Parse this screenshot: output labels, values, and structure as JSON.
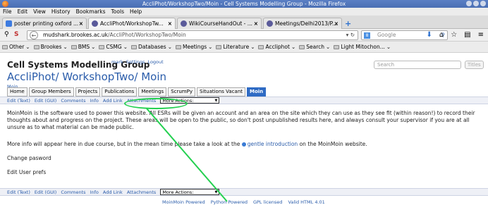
{
  "window": {
    "title": "AccliPhot/WorkshopTwo/Moin - Cell Systems Modelling Group - Mozilla Firefox"
  },
  "menu": [
    "File",
    "Edit",
    "View",
    "History",
    "Bookmarks",
    "Tools",
    "Help"
  ],
  "tabs": [
    {
      "label": "poster printing oxford ...",
      "color": "#3d7be0"
    },
    {
      "label": "AccliPhot/WorkshopTw...",
      "color": "#3d7be0",
      "active": true
    },
    {
      "label": "WikiCourseHandOut - ...",
      "color": "#3d7be0"
    },
    {
      "label": "Meetings/Delhi2013/P...",
      "color": "#3d7be0"
    }
  ],
  "nav": {
    "url_domain": "mudshark.brookes.ac.uk",
    "url_path": "/AccliPhot/WorkshopTwo/Moin",
    "search_placeholder": "Google"
  },
  "bookmarks": [
    "Other",
    "Brookes",
    "BMS",
    "CSMG",
    "Databases",
    "Meetings",
    "Literature",
    "Accliphot",
    "Search",
    "Light Mitochon..."
  ],
  "wiki": {
    "site_title": "Cell Systems Modelling Group",
    "user_links": [
      "mark",
      "Settings",
      "Logout"
    ],
    "search_placeholder": "Search",
    "titles_button": "Titles",
    "text_button": "Text",
    "page_title": "AccliPhot/ WorkshopTwo/ Moin",
    "breadcrumb": "Moin",
    "navtabs": [
      "Home",
      "Group Members",
      "Projects",
      "Publications",
      "Meetings",
      "ScrumPy",
      "Situations Vacant",
      "Moin"
    ],
    "editbar": [
      "Edit (Text)",
      "Edit (GUI)",
      "Comments",
      "Info",
      "Add Link",
      "Attachments"
    ],
    "more_actions": "More Actions:",
    "paragraph1": "MoinMoin is the software used to power this website. All ESRs will be given an account and an area on the site which they can use as they see fit (within reason!) to record their thoughts about and progress on the project. These areas will be open to the public, so don't post unpublished results here, and always consult your supervisor if you are at all unsure as to what material can be made public.",
    "paragraph2_pre": "More info will appear here in due course, but in the mean time please take a look at the",
    "paragraph2_link": "gentle introduction",
    "paragraph2_post": "on the MoinMoin website.",
    "link_change_password": "Change pasword",
    "link_edit_prefs": "Edit User prefs",
    "footer": [
      "MoinMoin Powered",
      "Python Powered",
      "GPL licensed",
      "Valid HTML 4.01"
    ]
  },
  "annotation_color": "#24d050"
}
